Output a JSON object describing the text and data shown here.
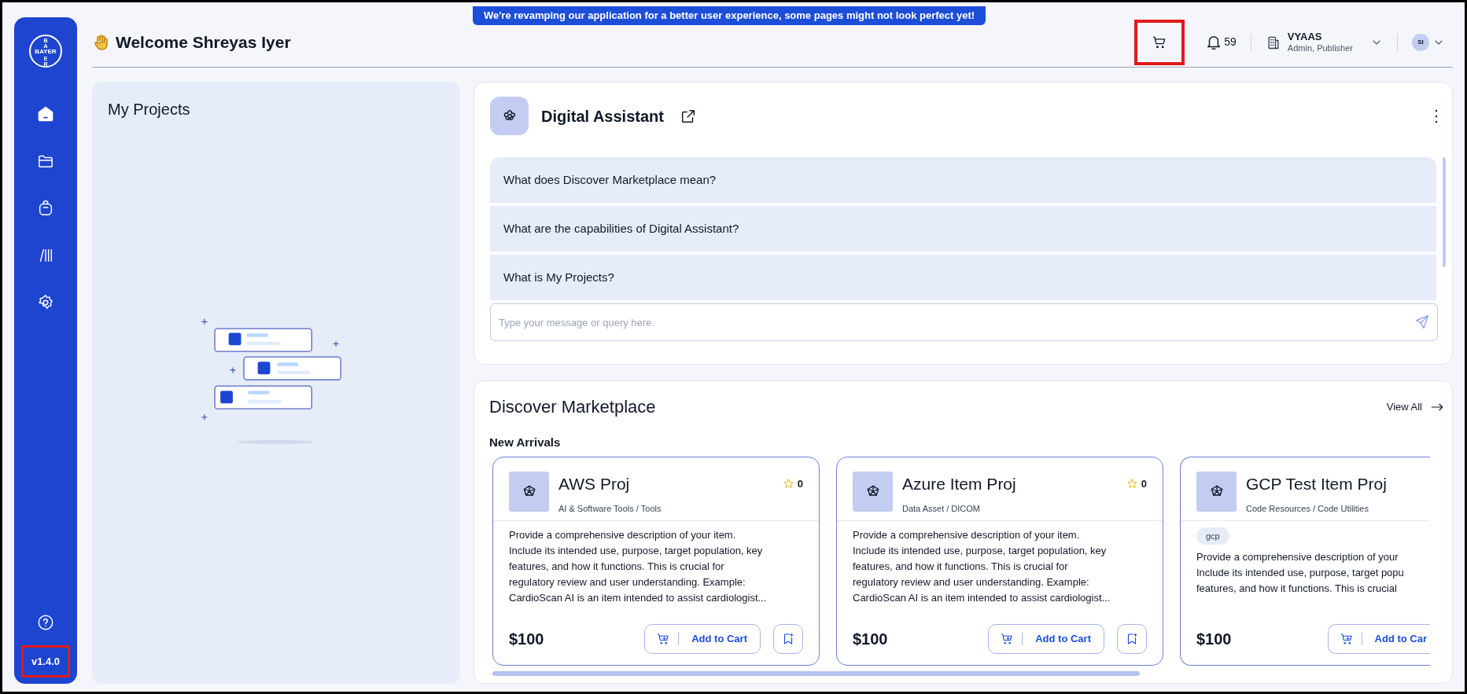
{
  "banner": "We're revamping our application for a better user experience, some pages might not look perfect yet!",
  "sidebar": {
    "logo": {
      "across": "BAYER",
      "top": "BA",
      "bottom": "ER"
    },
    "nav": [
      {
        "kind": "home",
        "selected": true
      },
      {
        "kind": "folder",
        "selected": false
      },
      {
        "kind": "bag",
        "selected": false
      },
      {
        "kind": "library",
        "selected": false
      },
      {
        "kind": "settings",
        "selected": false
      }
    ],
    "version": {
      "label": "v1.4.0",
      "highlighted": true
    }
  },
  "header": {
    "title": "Welcome Shreyas Iyer",
    "cart": {
      "highlighted": true
    },
    "notifications": "59",
    "org": "VYAAS",
    "role": "Admin, Publisher",
    "avatar": "SI"
  },
  "my_projects": {
    "title": "My Projects"
  },
  "assistant": {
    "title": "Digital Assistant",
    "questions": [
      "What does Discover Marketplace mean?",
      "What are the capabilities of Digital Assistant?",
      "What is My Projects?"
    ],
    "placeholder": "Type your message or query here."
  },
  "marketplace": {
    "title": "Discover Marketplace",
    "view_all": "View All",
    "section": "New Arrivals",
    "cards": [
      {
        "title": "AWS Proj",
        "category": "AI & Software Tools / Tools",
        "rating": "0",
        "description_lines": [
          "Provide a comprehensive description of your item.",
          "Include its intended use, purpose, target population, key",
          "features, and how it functions. This is crucial for",
          "regulatory review and user understanding. Example:",
          "CardioScan AI is an item intended to assist cardiologist..."
        ],
        "price": "$100",
        "add_label": "Add to Cart"
      },
      {
        "title": "Azure Item Proj",
        "category": "Data Asset / DICOM",
        "rating": "0",
        "description_lines": [
          "Provide a comprehensive description of your item.",
          "Include its intended use, purpose, target population, key",
          "features, and how it functions. This is crucial for",
          "regulatory review and user understanding. Example:",
          "CardioScan AI is an item intended to assist cardiologist..."
        ],
        "price": "$100",
        "add_label": "Add to Cart"
      },
      {
        "title": "GCP Test Item Proj",
        "category": "Code Resources / Code Utilities",
        "tags": [
          "gcp"
        ],
        "description_lines": [
          "Provide a comprehensive description of your",
          "Include its intended use, purpose, target popu",
          "features, and how it functions. This is crucial"
        ],
        "price": "$100",
        "add_label": "Add to Car",
        "cut": true
      }
    ]
  }
}
